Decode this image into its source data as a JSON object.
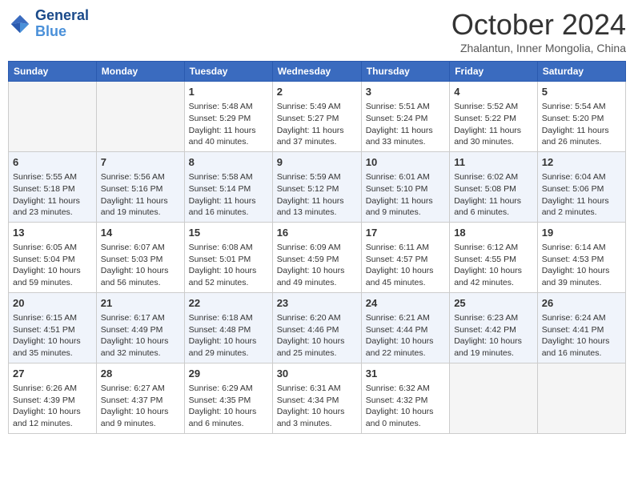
{
  "logo": {
    "line1": "General",
    "line2": "Blue"
  },
  "title": "October 2024",
  "location": "Zhalantun, Inner Mongolia, China",
  "headers": [
    "Sunday",
    "Monday",
    "Tuesday",
    "Wednesday",
    "Thursday",
    "Friday",
    "Saturday"
  ],
  "weeks": [
    [
      {
        "day": "",
        "empty": true
      },
      {
        "day": "",
        "empty": true
      },
      {
        "day": "1",
        "sunrise": "Sunrise: 5:48 AM",
        "sunset": "Sunset: 5:29 PM",
        "daylight": "Daylight: 11 hours and 40 minutes."
      },
      {
        "day": "2",
        "sunrise": "Sunrise: 5:49 AM",
        "sunset": "Sunset: 5:27 PM",
        "daylight": "Daylight: 11 hours and 37 minutes."
      },
      {
        "day": "3",
        "sunrise": "Sunrise: 5:51 AM",
        "sunset": "Sunset: 5:24 PM",
        "daylight": "Daylight: 11 hours and 33 minutes."
      },
      {
        "day": "4",
        "sunrise": "Sunrise: 5:52 AM",
        "sunset": "Sunset: 5:22 PM",
        "daylight": "Daylight: 11 hours and 30 minutes."
      },
      {
        "day": "5",
        "sunrise": "Sunrise: 5:54 AM",
        "sunset": "Sunset: 5:20 PM",
        "daylight": "Daylight: 11 hours and 26 minutes."
      }
    ],
    [
      {
        "day": "6",
        "sunrise": "Sunrise: 5:55 AM",
        "sunset": "Sunset: 5:18 PM",
        "daylight": "Daylight: 11 hours and 23 minutes."
      },
      {
        "day": "7",
        "sunrise": "Sunrise: 5:56 AM",
        "sunset": "Sunset: 5:16 PM",
        "daylight": "Daylight: 11 hours and 19 minutes."
      },
      {
        "day": "8",
        "sunrise": "Sunrise: 5:58 AM",
        "sunset": "Sunset: 5:14 PM",
        "daylight": "Daylight: 11 hours and 16 minutes."
      },
      {
        "day": "9",
        "sunrise": "Sunrise: 5:59 AM",
        "sunset": "Sunset: 5:12 PM",
        "daylight": "Daylight: 11 hours and 13 minutes."
      },
      {
        "day": "10",
        "sunrise": "Sunrise: 6:01 AM",
        "sunset": "Sunset: 5:10 PM",
        "daylight": "Daylight: 11 hours and 9 minutes."
      },
      {
        "day": "11",
        "sunrise": "Sunrise: 6:02 AM",
        "sunset": "Sunset: 5:08 PM",
        "daylight": "Daylight: 11 hours and 6 minutes."
      },
      {
        "day": "12",
        "sunrise": "Sunrise: 6:04 AM",
        "sunset": "Sunset: 5:06 PM",
        "daylight": "Daylight: 11 hours and 2 minutes."
      }
    ],
    [
      {
        "day": "13",
        "sunrise": "Sunrise: 6:05 AM",
        "sunset": "Sunset: 5:04 PM",
        "daylight": "Daylight: 10 hours and 59 minutes."
      },
      {
        "day": "14",
        "sunrise": "Sunrise: 6:07 AM",
        "sunset": "Sunset: 5:03 PM",
        "daylight": "Daylight: 10 hours and 56 minutes."
      },
      {
        "day": "15",
        "sunrise": "Sunrise: 6:08 AM",
        "sunset": "Sunset: 5:01 PM",
        "daylight": "Daylight: 10 hours and 52 minutes."
      },
      {
        "day": "16",
        "sunrise": "Sunrise: 6:09 AM",
        "sunset": "Sunset: 4:59 PM",
        "daylight": "Daylight: 10 hours and 49 minutes."
      },
      {
        "day": "17",
        "sunrise": "Sunrise: 6:11 AM",
        "sunset": "Sunset: 4:57 PM",
        "daylight": "Daylight: 10 hours and 45 minutes."
      },
      {
        "day": "18",
        "sunrise": "Sunrise: 6:12 AM",
        "sunset": "Sunset: 4:55 PM",
        "daylight": "Daylight: 10 hours and 42 minutes."
      },
      {
        "day": "19",
        "sunrise": "Sunrise: 6:14 AM",
        "sunset": "Sunset: 4:53 PM",
        "daylight": "Daylight: 10 hours and 39 minutes."
      }
    ],
    [
      {
        "day": "20",
        "sunrise": "Sunrise: 6:15 AM",
        "sunset": "Sunset: 4:51 PM",
        "daylight": "Daylight: 10 hours and 35 minutes."
      },
      {
        "day": "21",
        "sunrise": "Sunrise: 6:17 AM",
        "sunset": "Sunset: 4:49 PM",
        "daylight": "Daylight: 10 hours and 32 minutes."
      },
      {
        "day": "22",
        "sunrise": "Sunrise: 6:18 AM",
        "sunset": "Sunset: 4:48 PM",
        "daylight": "Daylight: 10 hours and 29 minutes."
      },
      {
        "day": "23",
        "sunrise": "Sunrise: 6:20 AM",
        "sunset": "Sunset: 4:46 PM",
        "daylight": "Daylight: 10 hours and 25 minutes."
      },
      {
        "day": "24",
        "sunrise": "Sunrise: 6:21 AM",
        "sunset": "Sunset: 4:44 PM",
        "daylight": "Daylight: 10 hours and 22 minutes."
      },
      {
        "day": "25",
        "sunrise": "Sunrise: 6:23 AM",
        "sunset": "Sunset: 4:42 PM",
        "daylight": "Daylight: 10 hours and 19 minutes."
      },
      {
        "day": "26",
        "sunrise": "Sunrise: 6:24 AM",
        "sunset": "Sunset: 4:41 PM",
        "daylight": "Daylight: 10 hours and 16 minutes."
      }
    ],
    [
      {
        "day": "27",
        "sunrise": "Sunrise: 6:26 AM",
        "sunset": "Sunset: 4:39 PM",
        "daylight": "Daylight: 10 hours and 12 minutes."
      },
      {
        "day": "28",
        "sunrise": "Sunrise: 6:27 AM",
        "sunset": "Sunset: 4:37 PM",
        "daylight": "Daylight: 10 hours and 9 minutes."
      },
      {
        "day": "29",
        "sunrise": "Sunrise: 6:29 AM",
        "sunset": "Sunset: 4:35 PM",
        "daylight": "Daylight: 10 hours and 6 minutes."
      },
      {
        "day": "30",
        "sunrise": "Sunrise: 6:31 AM",
        "sunset": "Sunset: 4:34 PM",
        "daylight": "Daylight: 10 hours and 3 minutes."
      },
      {
        "day": "31",
        "sunrise": "Sunrise: 6:32 AM",
        "sunset": "Sunset: 4:32 PM",
        "daylight": "Daylight: 10 hours and 0 minutes."
      },
      {
        "day": "",
        "empty": true
      },
      {
        "day": "",
        "empty": true
      }
    ]
  ]
}
